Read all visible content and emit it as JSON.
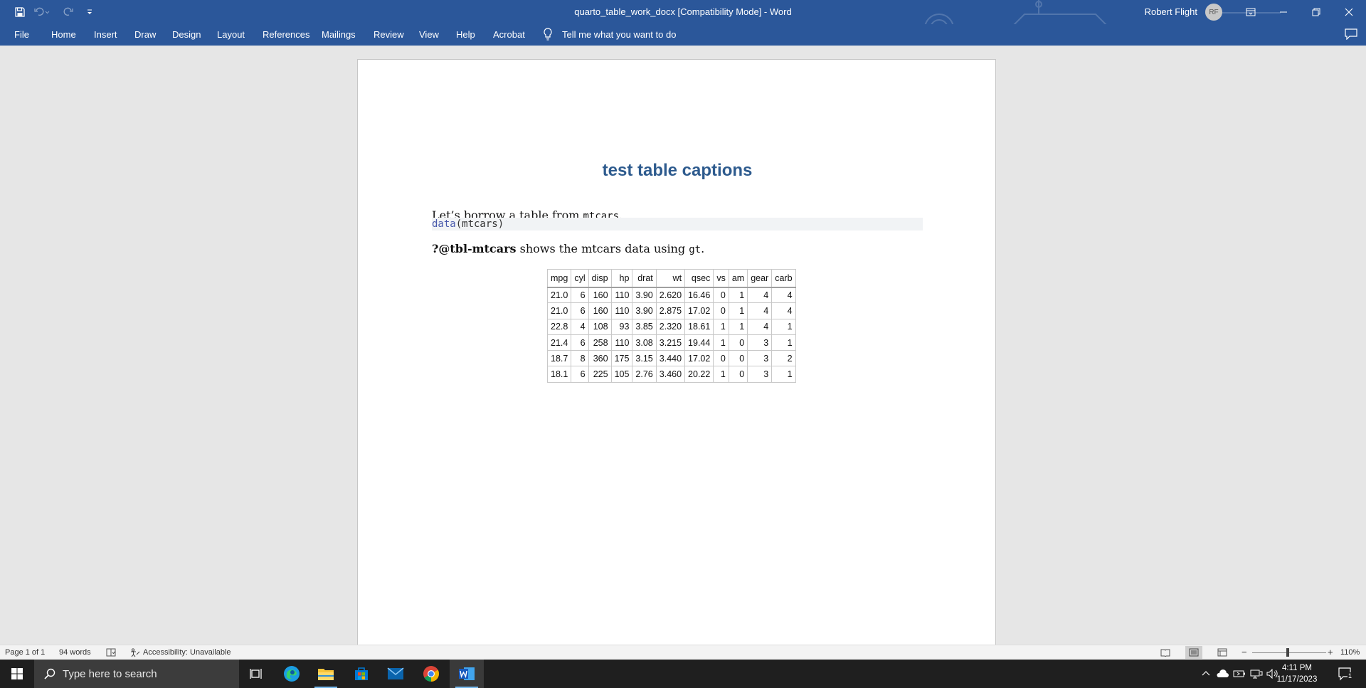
{
  "window": {
    "title": "quarto_table_work_docx [Compatibility Mode]  -  Word",
    "user_name": "Robert Flight",
    "user_initials": "RF",
    "accent_color": "#2b579a"
  },
  "ribbon": {
    "tabs": [
      "File",
      "Home",
      "Insert",
      "Draw",
      "Design",
      "Layout",
      "References",
      "Mailings",
      "Review",
      "View",
      "Help",
      "Acrobat"
    ],
    "tell_me": "Tell me what you want to do"
  },
  "document": {
    "heading": "test table captions",
    "para1_text": "Let’s borrow a table from ",
    "para1_code": "mtcars",
    "para1_end": ".",
    "code_fn": "data",
    "code_args": "(mtcars)",
    "para2_bold": "?@tbl-mtcars",
    "para2_text": " shows the mtcars data using ",
    "para2_code": "gt",
    "para2_end": ".",
    "table": {
      "headers": [
        "mpg",
        "cyl",
        "disp",
        "hp",
        "drat",
        "wt",
        "qsec",
        "vs",
        "am",
        "gear",
        "carb"
      ],
      "rows": [
        [
          "21.0",
          "6",
          "160",
          "110",
          "3.90",
          "2.620",
          "16.46",
          "0",
          "1",
          "4",
          "4"
        ],
        [
          "21.0",
          "6",
          "160",
          "110",
          "3.90",
          "2.875",
          "17.02",
          "0",
          "1",
          "4",
          "4"
        ],
        [
          "22.8",
          "4",
          "108",
          "93",
          "3.85",
          "2.320",
          "18.61",
          "1",
          "1",
          "4",
          "1"
        ],
        [
          "21.4",
          "6",
          "258",
          "110",
          "3.08",
          "3.215",
          "19.44",
          "1",
          "0",
          "3",
          "1"
        ],
        [
          "18.7",
          "8",
          "360",
          "175",
          "3.15",
          "3.440",
          "17.02",
          "0",
          "0",
          "3",
          "2"
        ],
        [
          "18.1",
          "6",
          "225",
          "105",
          "2.76",
          "3.460",
          "20.22",
          "1",
          "0",
          "3",
          "1"
        ]
      ]
    }
  },
  "statusbar": {
    "page": "Page 1 of 1",
    "words": "94 words",
    "accessibility": "Accessibility: Unavailable",
    "zoom": "110%"
  },
  "taskbar": {
    "search_placeholder": "Type here to search",
    "time": "4:11 PM",
    "date": "11/17/2023",
    "notification_count": "1"
  }
}
